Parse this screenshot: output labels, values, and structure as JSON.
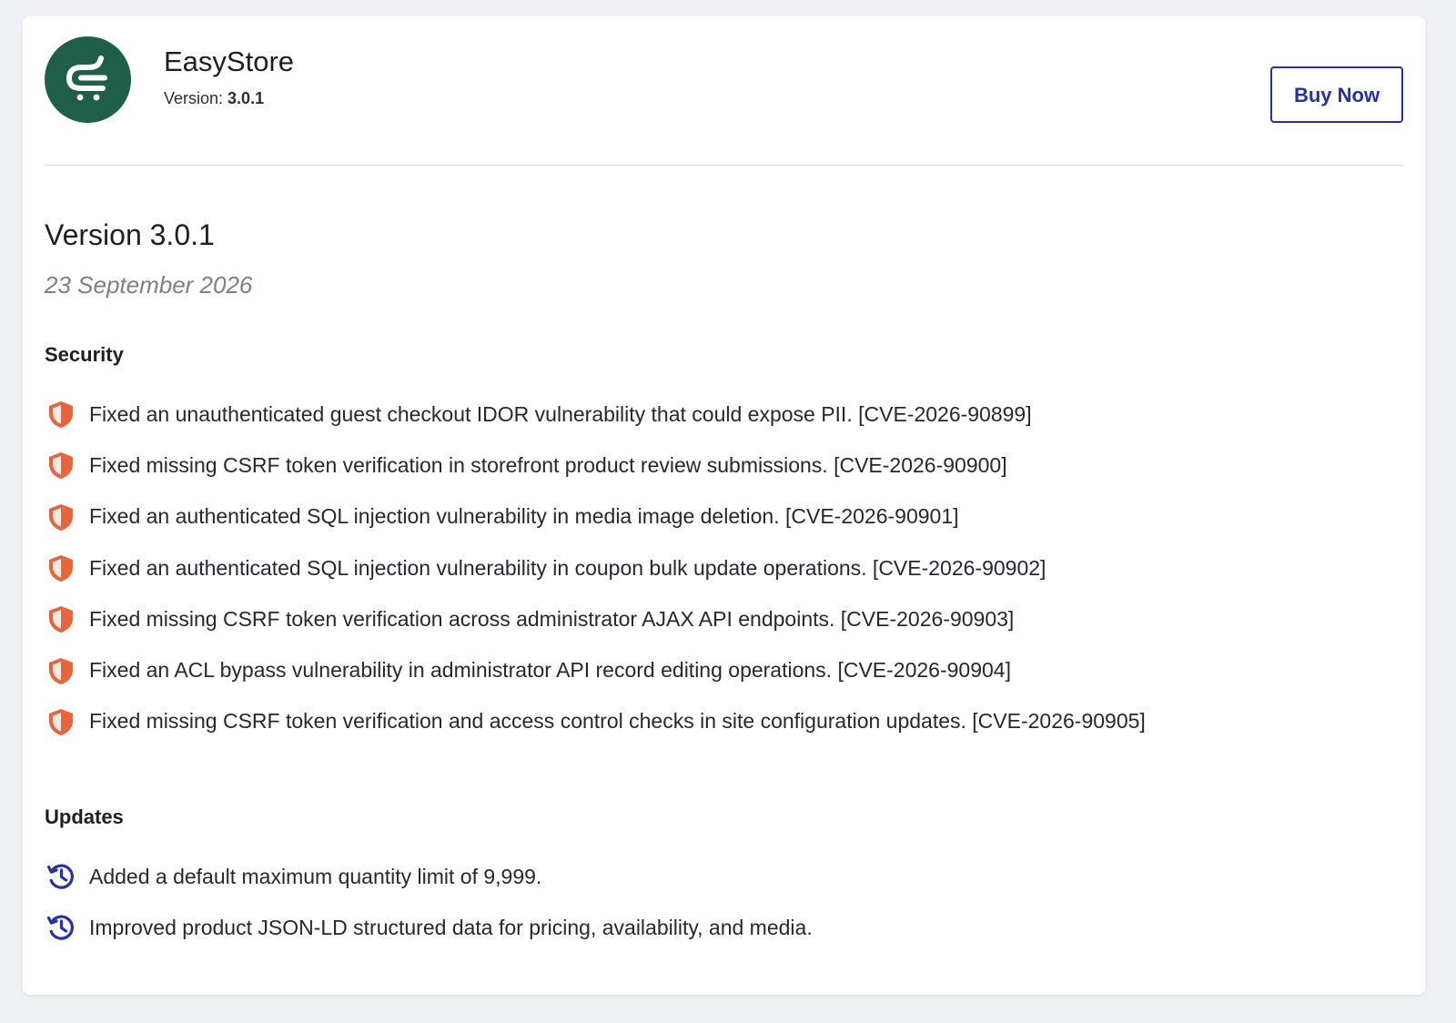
{
  "app": {
    "name": "EasyStore",
    "version_label": "Version: ",
    "version_value": "3.0.1",
    "buy_label": "Buy Now",
    "logo_color": "#1f5f49"
  },
  "release": {
    "title": "Version 3.0.1",
    "date": "23 September 2026"
  },
  "sections": {
    "security": {
      "title": "Security",
      "icon": "shield-icon",
      "icon_color": "#e8643a",
      "items": [
        "Fixed an unauthenticated guest checkout IDOR vulnerability that could expose PII. [CVE-2026-90899]",
        "Fixed missing CSRF token verification in storefront product review submissions. [CVE-2026-90900]",
        "Fixed an authenticated SQL injection vulnerability in media image deletion. [CVE-2026-90901]",
        "Fixed an authenticated SQL injection vulnerability in coupon bulk update operations. [CVE-2026-90902]",
        "Fixed missing CSRF token verification across administrator AJAX API endpoints. [CVE-2026-90903]",
        "Fixed an ACL bypass vulnerability in administrator API record editing operations. [CVE-2026-90904]",
        "Fixed missing CSRF token verification and access control checks in site configuration updates. [CVE-2026-90905]"
      ]
    },
    "updates": {
      "title": "Updates",
      "icon": "history-icon",
      "icon_color": "#2630a8",
      "items": [
        "Added a default maximum quantity limit of 9,999.",
        "Improved product JSON-LD structured data for pricing, availability, and media."
      ]
    }
  }
}
